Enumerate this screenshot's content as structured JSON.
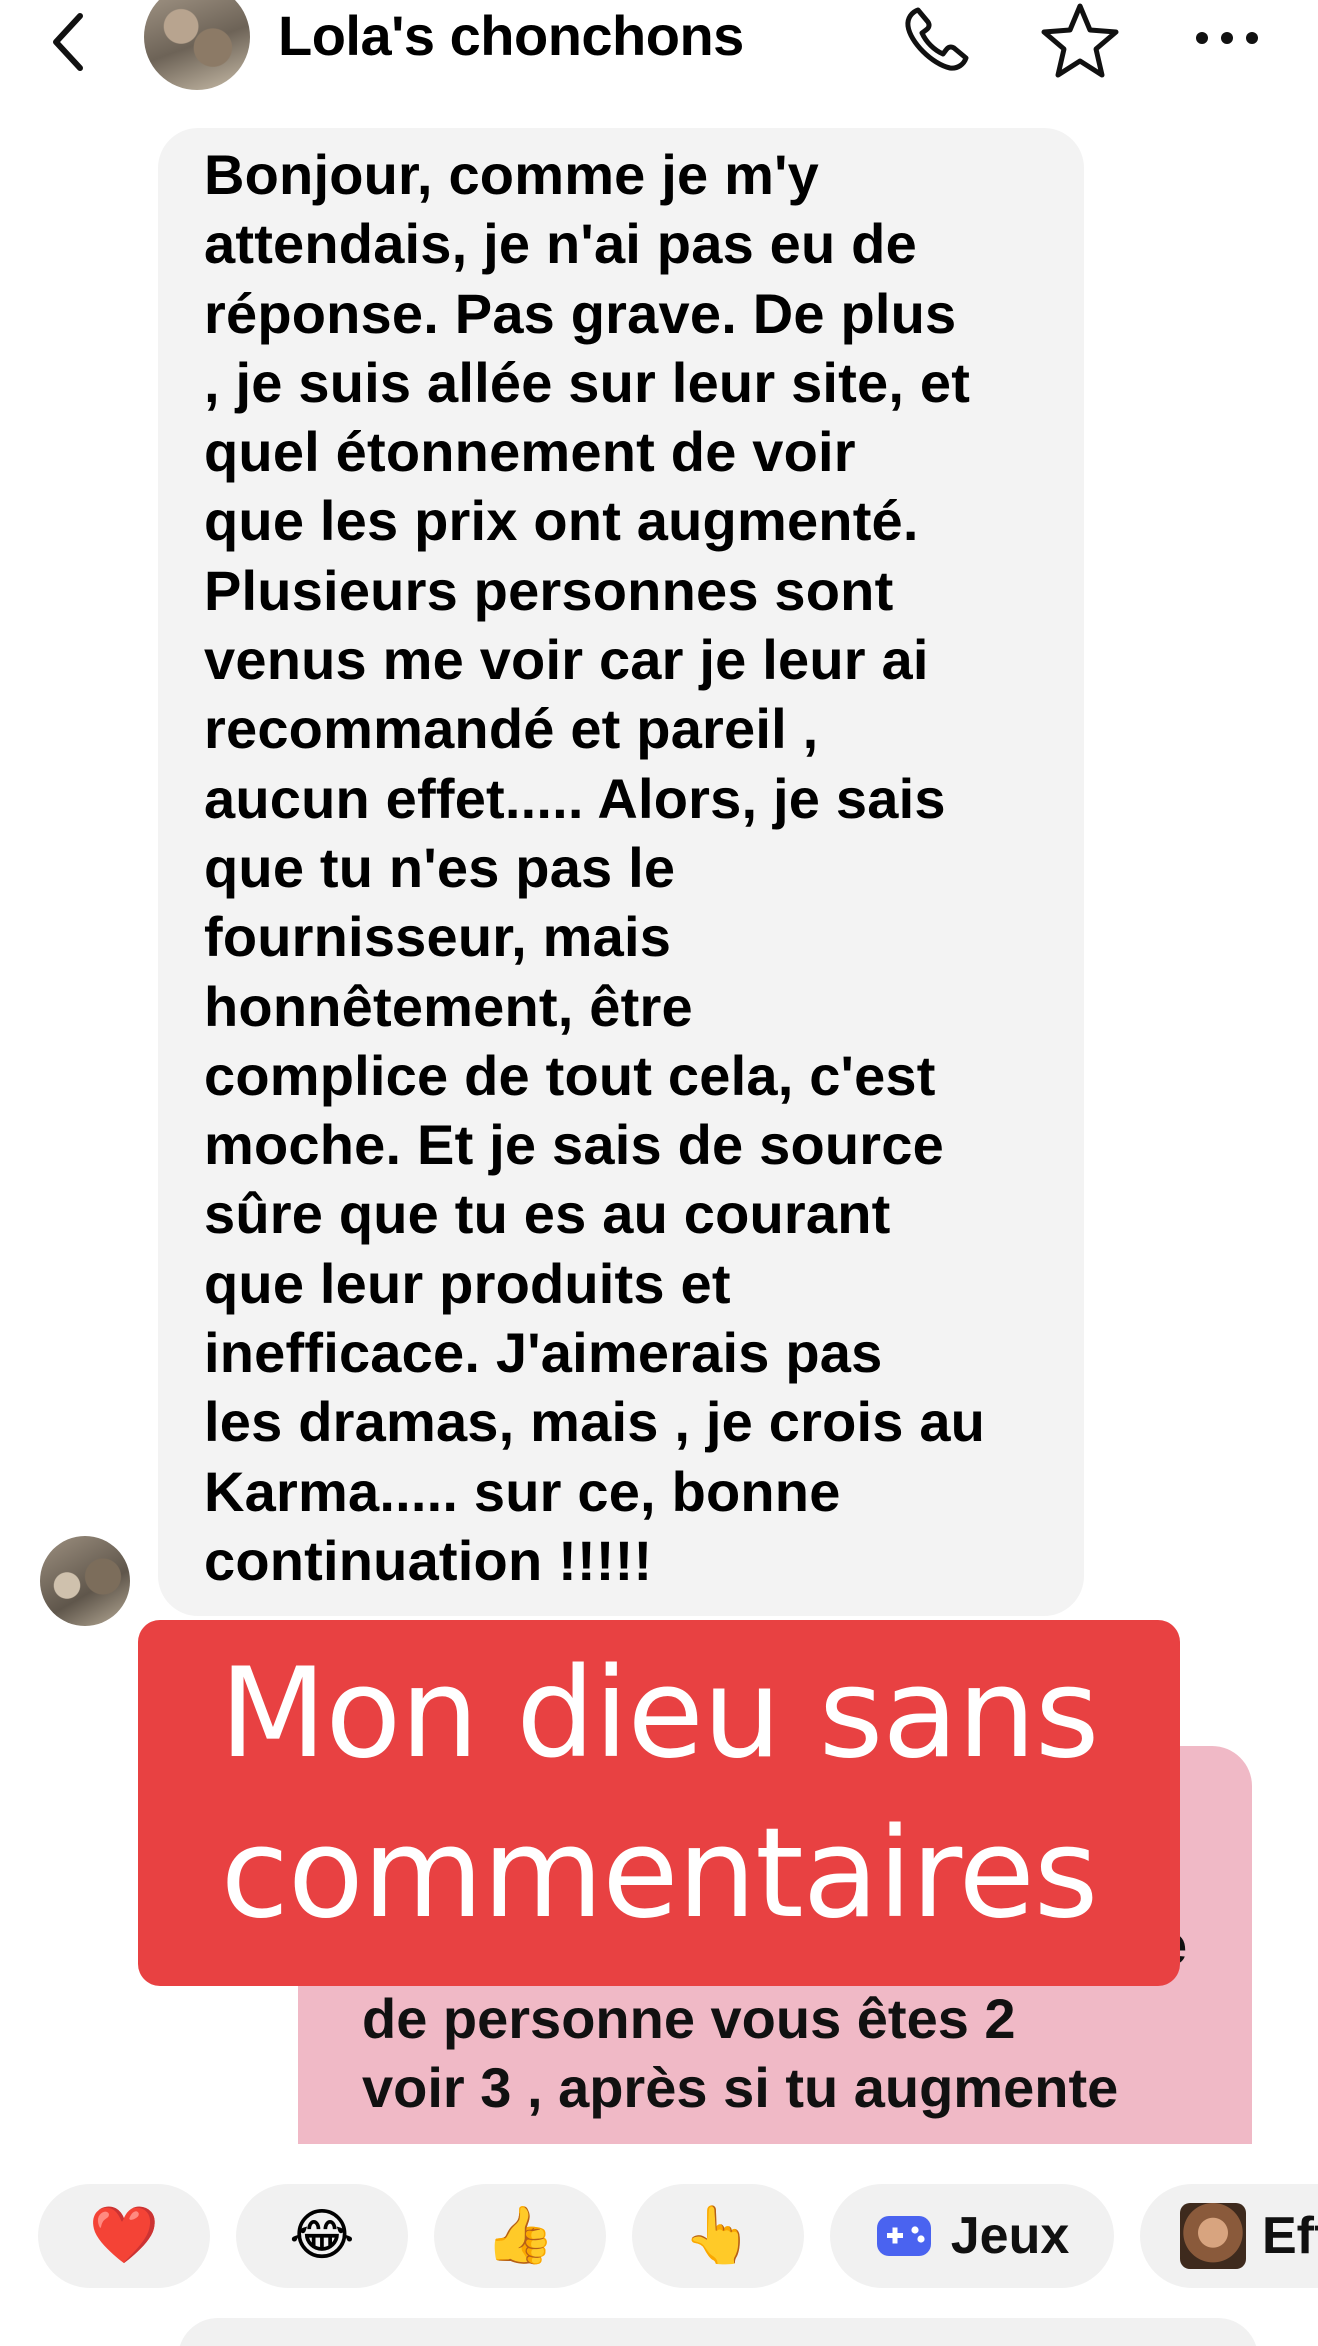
{
  "header": {
    "title": "Lola's chonchons",
    "icons": [
      "chevron-left-icon",
      "avatar",
      "phone-icon",
      "star-icon",
      "more-icon"
    ]
  },
  "messages": {
    "received": {
      "text": "Bonjour, comme je m'y\nattendais, je n'ai pas eu de\nréponse.  Pas grave. De plus\n, je suis allée sur leur site, et\nquel étonnement de voir\nque les prix ont augmenté.\nPlusieurs personnes sont\nvenus me voir car je leur ai\nrecommandé et pareil ,\naucun effet..... Alors, je sais\nque tu n'es pas le\nfournisseur,  mais\nhonnêtement,  être\ncomplice de tout cela, c'est\nmoche. Et je sais de source\nsûre que tu es au courant\nque leur produits et\ninefficace.  J'aimerais pas\nles dramas, mais , je crois au\nKarma..... sur ce, bonne\ncontinuation !!!!!"
    },
    "sent": {
      "text": "de personne vous êtes 2\nvoir 3 , après si tu augmente",
      "partial_tail": "e"
    }
  },
  "overlay": {
    "caption": "Mon dieu sans\ncommentaires",
    "color": "#e84142"
  },
  "reactions": {
    "heart": "❤️",
    "laugh": "😂",
    "thumbs_up": "👍",
    "point": "👆",
    "games_label": "Jeux",
    "effects_label": "Eff"
  },
  "colors": {
    "received_bubble": "#f3f3f3",
    "sent_bubble": "#f0b9c6",
    "games_icon": "#4a63f0"
  }
}
